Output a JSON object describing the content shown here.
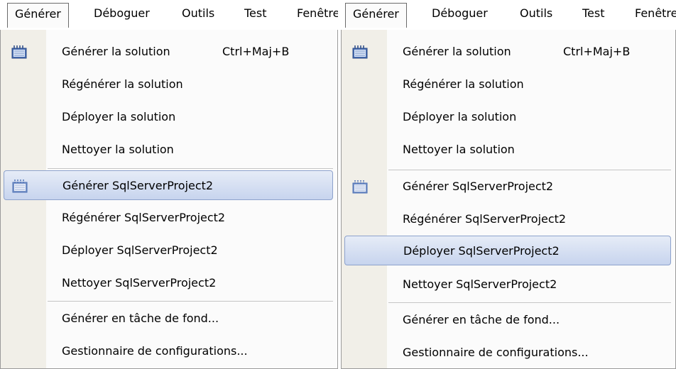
{
  "menubar": [
    "Générer",
    "Déboguer",
    "Outils",
    "Test",
    "Fenêtre"
  ],
  "left": {
    "items": [
      {
        "label": "Générer la solution",
        "shortcut": "Ctrl+Maj+B",
        "icon": "build-solution-icon"
      },
      {
        "label": "Régénérer la solution"
      },
      {
        "label": "Déployer la solution"
      },
      {
        "label": "Nettoyer la solution"
      },
      {
        "label": "Générer SqlServerProject2",
        "icon": "build-project-icon",
        "highlighted": true
      },
      {
        "label": "Régénérer SqlServerProject2"
      },
      {
        "label": "Déployer SqlServerProject2"
      },
      {
        "label": "Nettoyer SqlServerProject2"
      },
      {
        "label": "Générer en tâche de fond..."
      },
      {
        "label": "Gestionnaire de configurations..."
      }
    ]
  },
  "right": {
    "items": [
      {
        "label": "Générer la solution",
        "shortcut": "Ctrl+Maj+B",
        "icon": "build-solution-icon"
      },
      {
        "label": "Régénérer la solution"
      },
      {
        "label": "Déployer la solution"
      },
      {
        "label": "Nettoyer la solution"
      },
      {
        "label": "Générer SqlServerProject2",
        "icon": "build-project-icon"
      },
      {
        "label": "Régénérer SqlServerProject2"
      },
      {
        "label": "Déployer SqlServerProject2",
        "highlighted": true
      },
      {
        "label": "Nettoyer SqlServerProject2"
      },
      {
        "label": "Générer en tâche de fond..."
      },
      {
        "label": "Gestionnaire de configurations..."
      }
    ]
  },
  "colors": {
    "highlight": "#c7d4ee",
    "highlight_border": "#8da2cc",
    "gutter": "#f1efe8"
  }
}
